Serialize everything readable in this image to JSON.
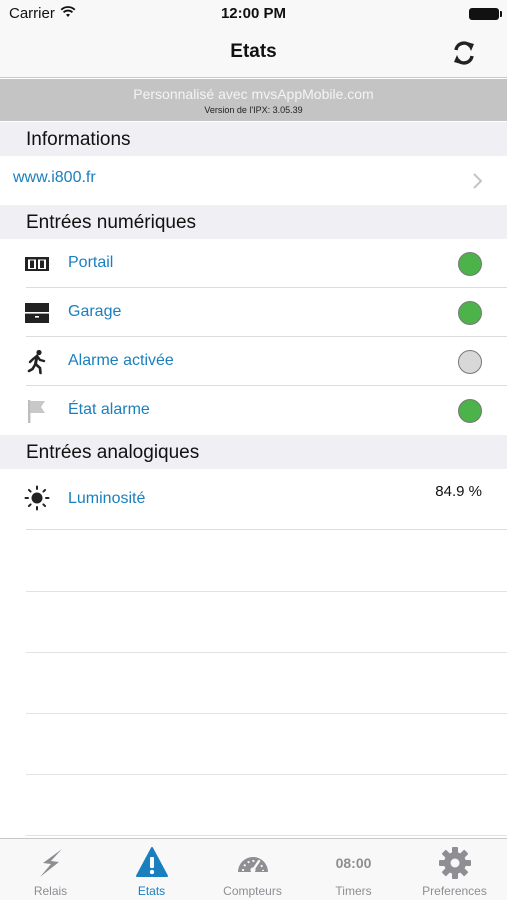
{
  "status_bar": {
    "carrier": "Carrier",
    "time": "12:00 PM"
  },
  "nav": {
    "title": "Etats",
    "sync_icon": "sync-icon"
  },
  "promo": {
    "line1": "Personnalisé avec mvsAppMobile.com",
    "line2": "Version de l'IPX: 3.05.39"
  },
  "sections": {
    "informations": "Informations",
    "digital": "Entrées numériques",
    "analog": "Entrées analogiques"
  },
  "info_link": {
    "label": "www.i800.fr"
  },
  "digital_inputs": [
    {
      "label": "Portail",
      "icon": "gate-icon",
      "state": "on"
    },
    {
      "label": "Garage",
      "icon": "garage-icon",
      "state": "on"
    },
    {
      "label": "Alarme activée",
      "icon": "running-person-icon",
      "state": "off"
    },
    {
      "label": "État alarme",
      "icon": "flag-icon",
      "state": "on"
    }
  ],
  "analog_inputs": [
    {
      "label": "Luminosité",
      "icon": "sun-icon",
      "value": "84.9 %"
    }
  ],
  "tabs": [
    {
      "label": "Relais",
      "icon": "lightning-icon",
      "active": false
    },
    {
      "label": "Etats",
      "icon": "alert-icon",
      "active": true
    },
    {
      "label": "Compteurs",
      "icon": "gauge-icon",
      "active": false
    },
    {
      "label": "Timers",
      "icon": "clock-text-icon",
      "time": "08:00",
      "active": false
    },
    {
      "label": "Preferences",
      "icon": "gear-icon",
      "active": false
    }
  ],
  "colors": {
    "accent": "#1a7fbf",
    "on": "#4cb34a",
    "off": "#d8d8d8"
  }
}
